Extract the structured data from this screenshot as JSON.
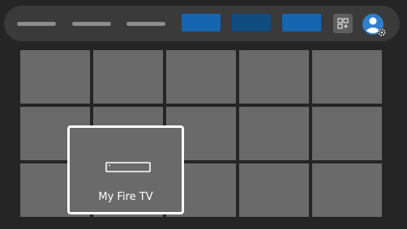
{
  "colors": {
    "background": "#252525",
    "nav_bar": "#3a3a3a",
    "nav_line": "#8c8c8c",
    "tile": "#6a6a6a",
    "nav_tile_dark": "#0f4c80",
    "nav_tile_accent": "#1565b0",
    "focus_border": "#ffffff",
    "profile_blue": "#2f7fcc"
  },
  "icons": {
    "apps": "apps-grid-plus-icon",
    "profile": "profile-settings-icon",
    "device": "fire-tv-stick-icon"
  },
  "focused_tile": {
    "label": "My Fire TV"
  }
}
